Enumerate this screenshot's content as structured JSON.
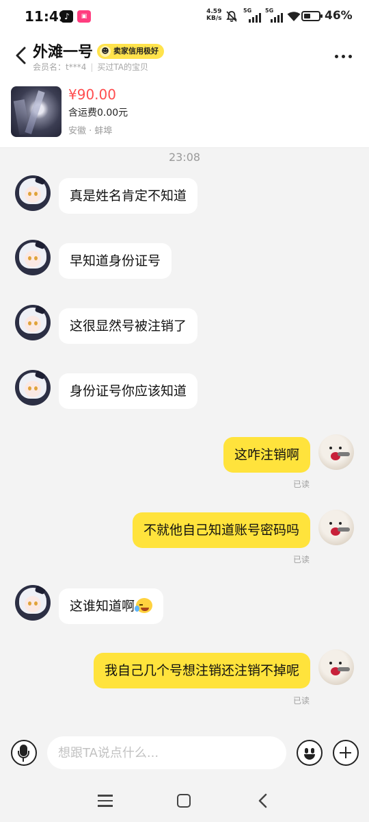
{
  "status_bar": {
    "time": "11:49",
    "speed_value": "4.59",
    "speed_unit": "KB/s",
    "sim1": "5G",
    "sim2": "5G",
    "battery_percent": "46%",
    "battery_level": 0.46,
    "apps": [
      "tiktok-icon",
      "bilibili-icon"
    ]
  },
  "header": {
    "title": "外滩一号",
    "badge": "卖家信用极好",
    "member_label": "会员名：t***4",
    "bought_label": "买过TA的宝贝"
  },
  "product": {
    "price": "¥90.00",
    "shipping": "含运费0.00元",
    "location": "安徽 · 蚌埠"
  },
  "chat": {
    "timestamp": "23:08",
    "messages": [
      {
        "sender": "other",
        "text": "真是姓名肯定不知道"
      },
      {
        "sender": "other",
        "text": "早知道身份证号"
      },
      {
        "sender": "other",
        "text": "这很显然号被注销了"
      },
      {
        "sender": "other",
        "text": "身份证号你应该知道"
      },
      {
        "sender": "self",
        "text": "这咋注销啊",
        "status": "已读"
      },
      {
        "sender": "self",
        "text": "不就他自己知道账号密码吗",
        "status": "已读"
      },
      {
        "sender": "other",
        "text": "这谁知道啊",
        "emoji": "laugh-cry-emoji"
      },
      {
        "sender": "self",
        "text": "我自己几个号想注销还注销不掉呢",
        "status": "已读"
      }
    ]
  },
  "input_bar": {
    "placeholder": "想跟TA说点什么..."
  },
  "colors": {
    "accent_yellow": "#ffe33c",
    "price_red": "#ff4d4f",
    "background": "#f3f3f3"
  }
}
